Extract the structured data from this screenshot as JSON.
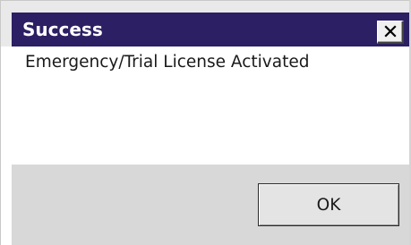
{
  "dialog": {
    "title": "Success",
    "message": "Emergency/Trial License Activated",
    "buttons": {
      "ok_label": "OK"
    },
    "icons": {
      "close": "close-icon"
    }
  },
  "colors": {
    "titlebar_active": "#2c1f63",
    "title_text": "#ffffff",
    "button_area": "#d8d8d8",
    "content_bg": "#ffffff"
  }
}
